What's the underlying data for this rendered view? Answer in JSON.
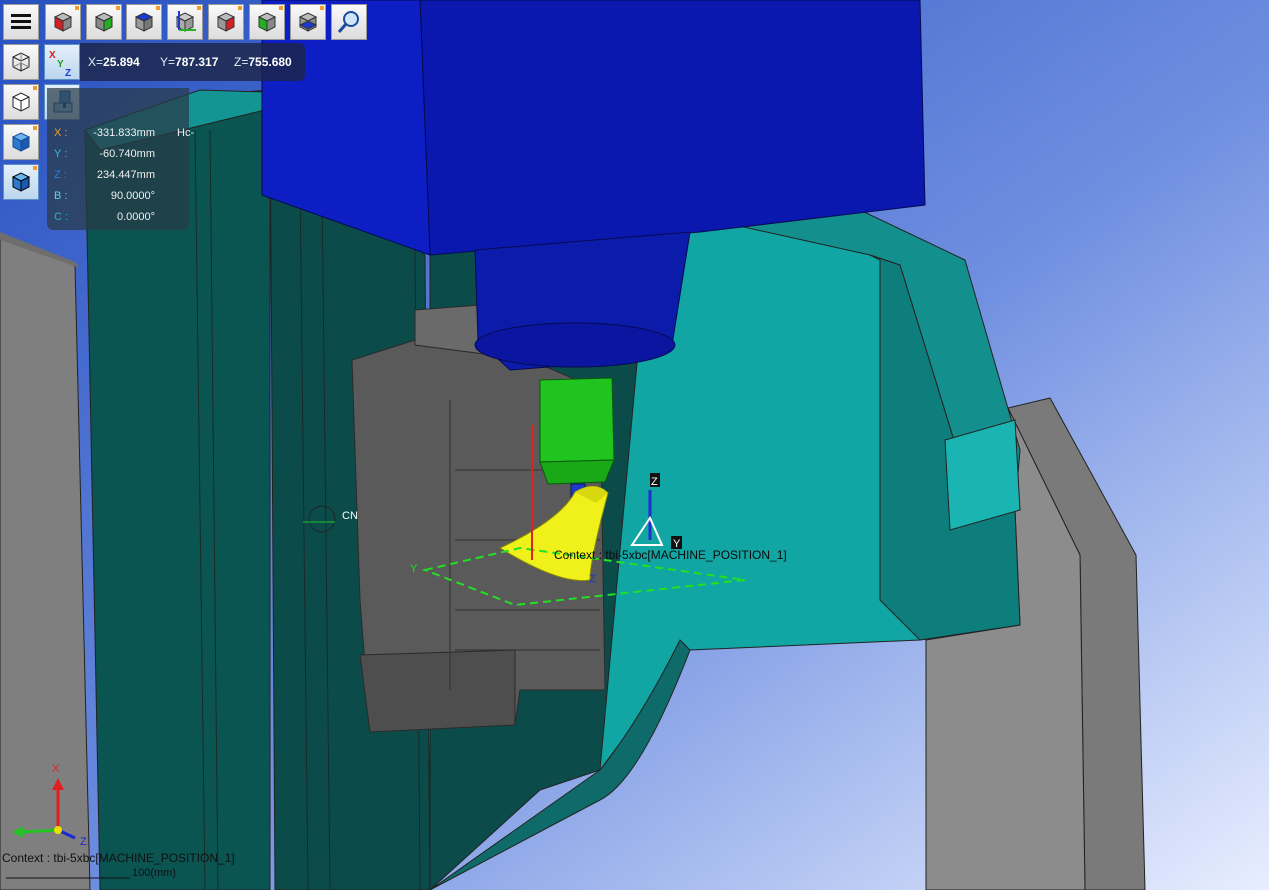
{
  "toolbar": {
    "menu_icon": "hamburger-menu-icon",
    "buttons": [
      {
        "id": "view-front",
        "icon": "cube-red-face-icon"
      },
      {
        "id": "view-side",
        "icon": "cube-green-face-icon"
      },
      {
        "id": "view-top",
        "icon": "cube-blue-face-icon"
      },
      {
        "id": "view-axes",
        "icon": "cube-axes-icon"
      },
      {
        "id": "view-back",
        "icon": "cube-red-face-icon"
      },
      {
        "id": "view-right",
        "icon": "cube-green-face-icon"
      },
      {
        "id": "view-bottom",
        "icon": "cube-blue-bottom-icon"
      },
      {
        "id": "zoom-fit",
        "icon": "zoom-magnifier-icon"
      }
    ]
  },
  "left_tools": [
    {
      "id": "wireframe-iso",
      "icon": "wireframe-cube-icon"
    },
    {
      "id": "wireframe-hidden",
      "icon": "wireframe-hidden-cube-icon"
    },
    {
      "id": "shaded",
      "icon": "shaded-cube-icon"
    },
    {
      "id": "shaded-edges",
      "icon": "shaded-edges-cube-icon"
    }
  ],
  "coordinates": {
    "x_label": "X=",
    "x_value": "25.894",
    "y_label": "Y=",
    "y_value": "787.317",
    "z_label": "Z=",
    "z_value": "755.680"
  },
  "axes_panel": {
    "rows": [
      {
        "label": "X :",
        "value": "-331.833mm",
        "color": "#f0a020"
      },
      {
        "label": "Y :",
        "value": "-60.740mm",
        "color": "#35b8e8"
      },
      {
        "label": "Z :",
        "value": "234.447mm",
        "color": "#2d7fe0"
      },
      {
        "label": "B :",
        "value": "90.0000°",
        "color": "#5fd8c8"
      },
      {
        "label": "C :",
        "value": "0.0000°",
        "color": "#2fb0a8"
      }
    ],
    "x_extra": "Hc-"
  },
  "scene": {
    "context_label": "Context : tbi-5xbc[MACHINE_POSITION_1]",
    "cnc_label": "CN",
    "triad_z": "Z",
    "triad_y": "Y",
    "part_axis_y": "Y",
    "part_axis_z": "Z"
  },
  "corner_triad": {
    "x": "X",
    "y": "Y",
    "z": "Z"
  },
  "status": {
    "context": "Context : tbi-5xbc[MACHINE_POSITION_1]",
    "scale": "100(mm)"
  },
  "colors": {
    "sky_top": "#2f5fc8",
    "sky_bottom": "#e6ecff",
    "spindle_blue": "#0a1aa8",
    "table_teal": "#0e8f8f",
    "fixture_gray": "#5a5a5a",
    "tool_green": "#22c422",
    "part_yellow": "#f2f21a"
  }
}
